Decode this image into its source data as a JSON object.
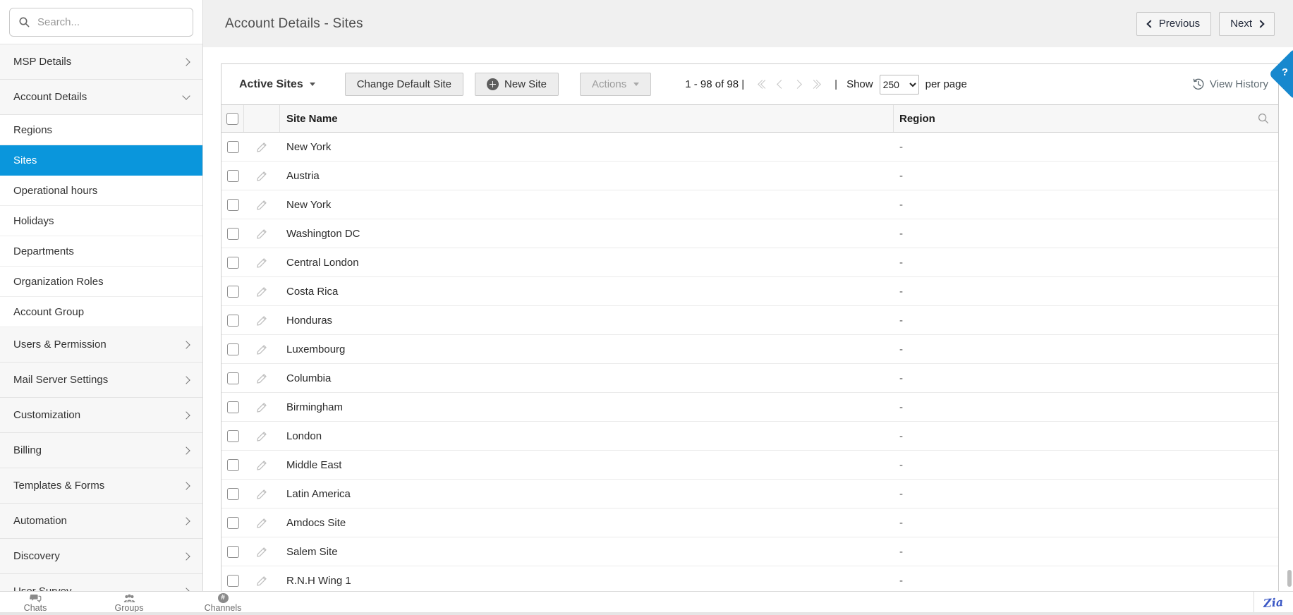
{
  "colors": {
    "accent_blue": "#0a96dc",
    "help_blue": "#1788ce",
    "zia_blue": "#3a57c5"
  },
  "sidebar": {
    "search_placeholder": "Search...",
    "items": [
      {
        "label": "MSP Details",
        "type": "parent",
        "chevron": "right"
      },
      {
        "label": "Account Details",
        "type": "parent",
        "chevron": "down"
      },
      {
        "label": "Regions",
        "type": "sub"
      },
      {
        "label": "Sites",
        "type": "sub",
        "selected": true
      },
      {
        "label": "Operational hours",
        "type": "sub"
      },
      {
        "label": "Holidays",
        "type": "sub"
      },
      {
        "label": "Departments",
        "type": "sub"
      },
      {
        "label": "Organization Roles",
        "type": "sub"
      },
      {
        "label": "Account Group",
        "type": "sub"
      },
      {
        "label": "Users & Permission",
        "type": "parent",
        "chevron": "right"
      },
      {
        "label": "Mail Server Settings",
        "type": "parent",
        "chevron": "right"
      },
      {
        "label": "Customization",
        "type": "parent",
        "chevron": "right"
      },
      {
        "label": "Billing",
        "type": "parent",
        "chevron": "right"
      },
      {
        "label": "Templates & Forms",
        "type": "parent",
        "chevron": "right"
      },
      {
        "label": "Automation",
        "type": "parent",
        "chevron": "right"
      },
      {
        "label": "Discovery",
        "type": "parent",
        "chevron": "right"
      },
      {
        "label": "User Survey",
        "type": "parent",
        "chevron": "right"
      }
    ]
  },
  "header": {
    "title": "Account Details - Sites",
    "previous_label": "Previous",
    "next_label": "Next"
  },
  "toolbar": {
    "view_selector": "Active Sites",
    "change_default_site_label": "Change Default Site",
    "new_site_label": "New Site",
    "actions_label": "Actions",
    "pagination_text": "1 - 98 of 98 |",
    "separator": "|",
    "show_label": "Show",
    "per_page_value": "250",
    "per_page_label": "per page",
    "view_history_label": "View History"
  },
  "table": {
    "columns": [
      "Site Name",
      "Region"
    ],
    "rows": [
      {
        "site_name": "New York",
        "region": "-"
      },
      {
        "site_name": "Austria",
        "region": "-"
      },
      {
        "site_name": "New York",
        "region": "-"
      },
      {
        "site_name": "Washington DC",
        "region": "-"
      },
      {
        "site_name": "Central London",
        "region": "-"
      },
      {
        "site_name": "Costa Rica",
        "region": "-"
      },
      {
        "site_name": "Honduras",
        "region": "-"
      },
      {
        "site_name": "Luxembourg",
        "region": "-"
      },
      {
        "site_name": "Columbia",
        "region": "-"
      },
      {
        "site_name": "Birmingham",
        "region": "-"
      },
      {
        "site_name": "London",
        "region": "-"
      },
      {
        "site_name": "Middle East",
        "region": "-"
      },
      {
        "site_name": "Latin America",
        "region": "-"
      },
      {
        "site_name": "Amdocs Site",
        "region": "-"
      },
      {
        "site_name": "Salem Site",
        "region": "-"
      },
      {
        "site_name": "R.N.H Wing 1",
        "region": "-"
      }
    ]
  },
  "help_badge": "?",
  "bottombar": {
    "items": [
      {
        "label": "Chats"
      },
      {
        "label": "Groups"
      },
      {
        "label": "Channels"
      }
    ],
    "channels_glyph": "#",
    "zia_label": "Zia"
  },
  "icons": {
    "sidebar_search": "magnifier",
    "new_site": "plus-circle",
    "view_history": "clock-history",
    "row_edit": "pencil",
    "column_search": "magnifier",
    "pagination": [
      "first-page",
      "previous-page",
      "next-page",
      "last-page"
    ]
  }
}
